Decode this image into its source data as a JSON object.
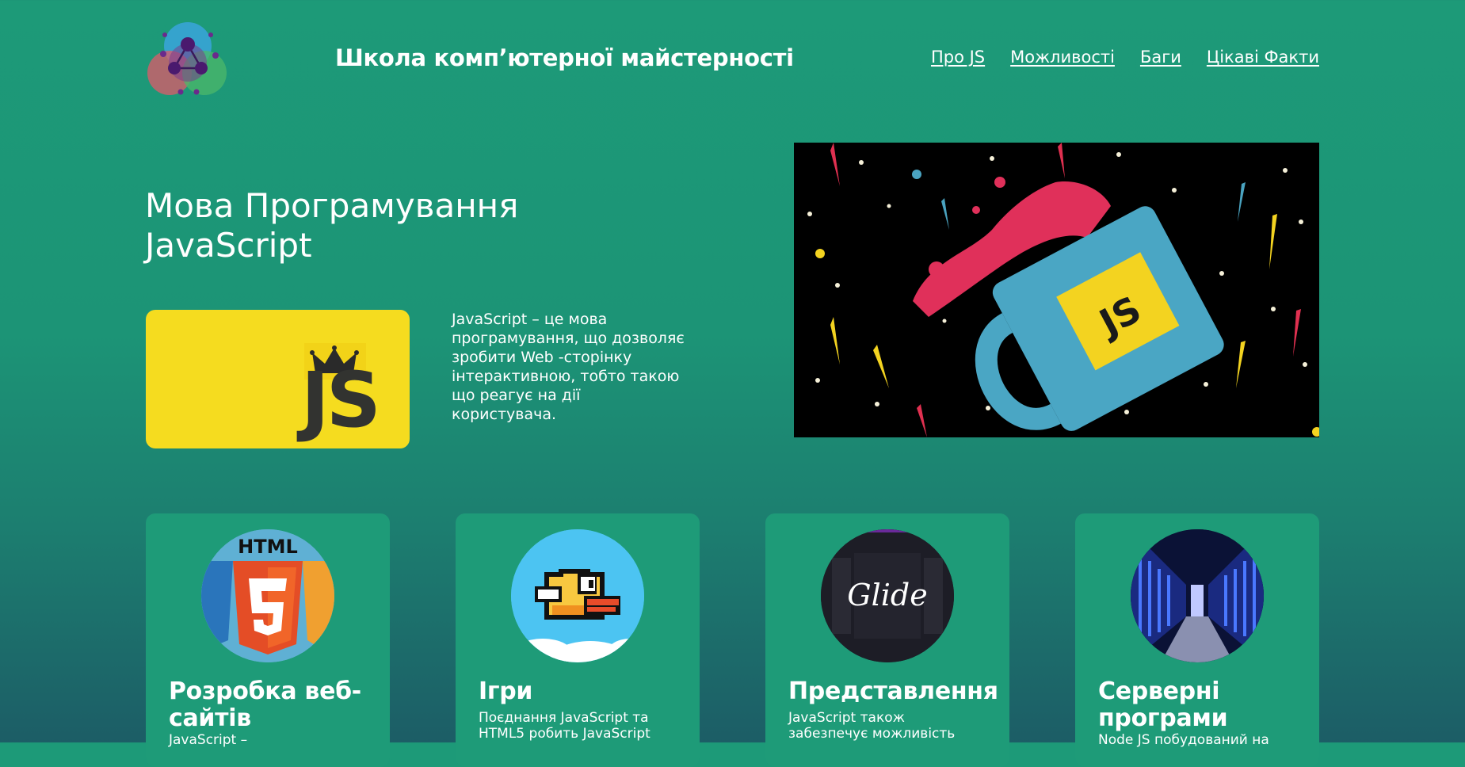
{
  "header": {
    "site_title": "Школа комп’ютерної майстерності",
    "logo_icon": "molecule-logo-icon",
    "nav": [
      {
        "label": "Про JS"
      },
      {
        "label": "Можливості"
      },
      {
        "label": "Баги"
      },
      {
        "label": "Цікаві Факти"
      }
    ]
  },
  "hero": {
    "title": "Мова Програмування JavaScript",
    "js_logo_text": "JS",
    "description": "JavaScript – це мова програмування, що дозволяє зробити Web -сторінку інтерактивною, тобто такою що реагує на дії користувача.",
    "mug_label": "JS"
  },
  "features": [
    {
      "title": "Розробка веб-сайтів",
      "description": "JavaScript –",
      "image_text": "HTML",
      "icon": "html5-css3-js-logos-icon"
    },
    {
      "title": "Ігри",
      "description": "Поєднання JavaScript та HTML5 робить JavaScript",
      "icon": "pixel-bird-icon"
    },
    {
      "title": "Представлення",
      "description": "JavaScript також забезпечує можливість",
      "image_text": "Glide",
      "icon": "glide-logo-icon"
    },
    {
      "title": "Серверні програми",
      "description": "Node JS побудований на",
      "icon": "server-room-icon"
    }
  ],
  "colors": {
    "background_top": "#1d9a78",
    "background_bottom": "#1c5d66",
    "card": "#1e9b78",
    "js_yellow": "#f5dc1f"
  }
}
